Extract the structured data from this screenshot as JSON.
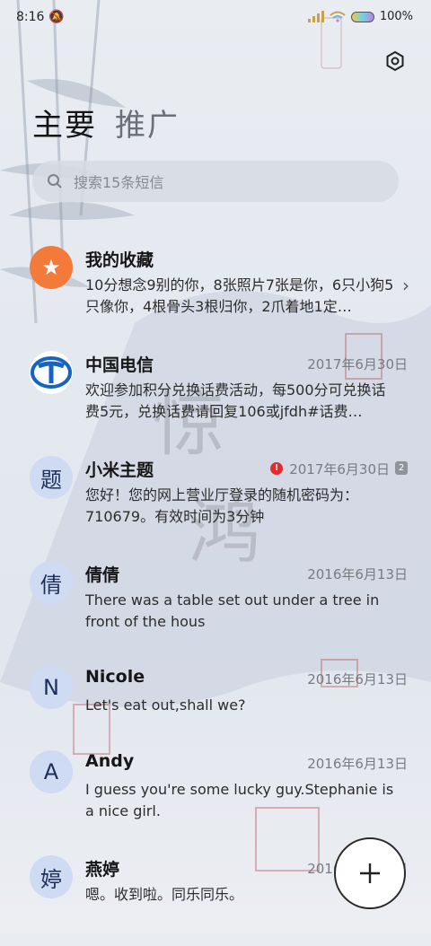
{
  "status_bar": {
    "time": "8:16",
    "battery": "100%"
  },
  "tabs": [
    {
      "label": "主要"
    },
    {
      "label": "推广"
    }
  ],
  "search": {
    "placeholder": "搜索15条短信"
  },
  "conversations": [
    {
      "avatar": "★",
      "name": "我的收藏",
      "date": "",
      "preview": "10分想念9别的你，8张照片7张是你，6只小狗5只像你，4根骨头3根归你，2爪着地1定…"
    },
    {
      "avatar": "",
      "name": "中国电信",
      "date": "2017年6月30日",
      "preview": "欢迎参加积分兑换话费活动，每500分可兑换话费5元，兑换话费请回复106或jfdh#话费…"
    },
    {
      "avatar": "题",
      "name": "小米主题",
      "date": "2017年6月30日",
      "sim": "2",
      "preview": "您好！您的网上营业厅登录的随机密码为：710679。有效时间为3分钟"
    },
    {
      "avatar": "倩",
      "name": "倩倩",
      "date": "2016年6月13日",
      "preview": "There was a table set out under a tree in front of the hous"
    },
    {
      "avatar": "N",
      "name": "Nicole",
      "date": "2016年6月13日",
      "preview": "Let's eat out,shall we?"
    },
    {
      "avatar": "A",
      "name": "Andy",
      "date": "2016年6月13日",
      "preview": "I guess you're some lucky guy.Stephanie is a nice girl."
    },
    {
      "avatar": "婷",
      "name": "燕婷",
      "date": "2016年6月13日",
      "preview": "嗯。收到啦。同乐同乐。"
    }
  ]
}
